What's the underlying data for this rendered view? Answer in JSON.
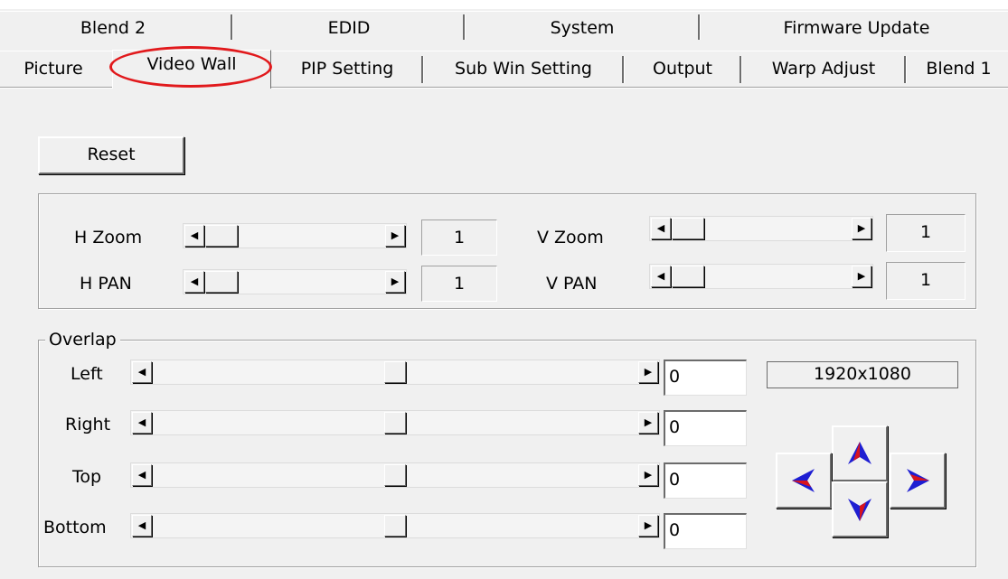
{
  "tabs_row1": [
    {
      "label": "Blend 2"
    },
    {
      "label": "EDID"
    },
    {
      "label": "System"
    },
    {
      "label": "Firmware Update"
    }
  ],
  "tabs_row2": [
    {
      "label": "Picture"
    },
    {
      "label": "Video Wall",
      "active": true
    },
    {
      "label": "PIP Setting"
    },
    {
      "label": "Sub Win Setting"
    },
    {
      "label": "Output"
    },
    {
      "label": "Warp Adjust"
    },
    {
      "label": "Blend 1"
    }
  ],
  "reset_button": "Reset",
  "zoom_pan": {
    "h_zoom": {
      "label": "H Zoom",
      "value": "1"
    },
    "v_zoom": {
      "label": "V Zoom",
      "value": "1"
    },
    "h_pan": {
      "label": "H PAN",
      "value": "1"
    },
    "v_pan": {
      "label": "V PAN",
      "value": "1"
    }
  },
  "overlap": {
    "title": "Overlap",
    "left": {
      "label": "Left",
      "value": "0",
      "slider_position": 0.5
    },
    "right": {
      "label": "Right",
      "value": "0",
      "slider_position": 0.5
    },
    "top": {
      "label": "Top",
      "value": "0",
      "slider_position": 0.5
    },
    "bottom": {
      "label": "Bottom",
      "value": "0",
      "slider_position": 0.5
    }
  },
  "resolution": "1920x1080",
  "direction_pad": {
    "up": "up-arrow-icon",
    "down": "down-arrow-icon",
    "left": "left-arrow-icon",
    "right": "right-arrow-icon"
  },
  "colors": {
    "highlight": "#e1191c",
    "arrow_red": "#d8141e",
    "arrow_blue": "#1e1ed2"
  }
}
